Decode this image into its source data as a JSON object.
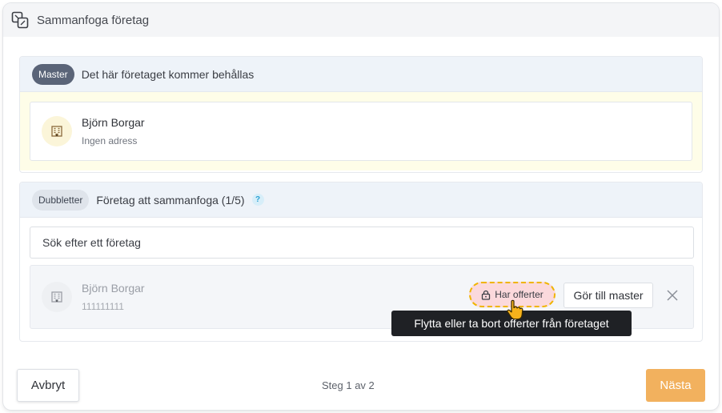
{
  "dialog": {
    "title": "Sammanfoga företag"
  },
  "master_section": {
    "badge": "Master",
    "title": "Det här företaget kommer behållas",
    "company": {
      "name": "Björn Borgar",
      "subtitle": "Ingen adress"
    }
  },
  "duplicates_section": {
    "badge": "Dubbletter",
    "title": "Företag att sammanfoga (1/5)",
    "help_glyph": "?",
    "search": {
      "placeholder": "Sök efter ett företag"
    },
    "items": [
      {
        "name": "Björn Borgar",
        "subtitle": "111111111",
        "offers_badge": "Har offerter",
        "make_master_label": "Gör till master"
      }
    ]
  },
  "tooltip": {
    "text": "Flytta eller ta bort offerter från företaget"
  },
  "footer": {
    "cancel_label": "Avbryt",
    "step_text": "Steg 1 av 2",
    "next_label": "Nästa"
  },
  "icons": {
    "header": "merge-icon",
    "company": "building-icon",
    "lock": "lock-icon",
    "remove": "close-icon",
    "cursor": "hand-pointer-icon"
  },
  "colors": {
    "master_badge": "#5a6478",
    "master_body_bg": "#fefde8",
    "offers_badge_bg": "#fbd9dc",
    "offers_badge_border": "#f0b400",
    "next_button": "#f2b15e",
    "tooltip_bg": "#1f2125"
  }
}
